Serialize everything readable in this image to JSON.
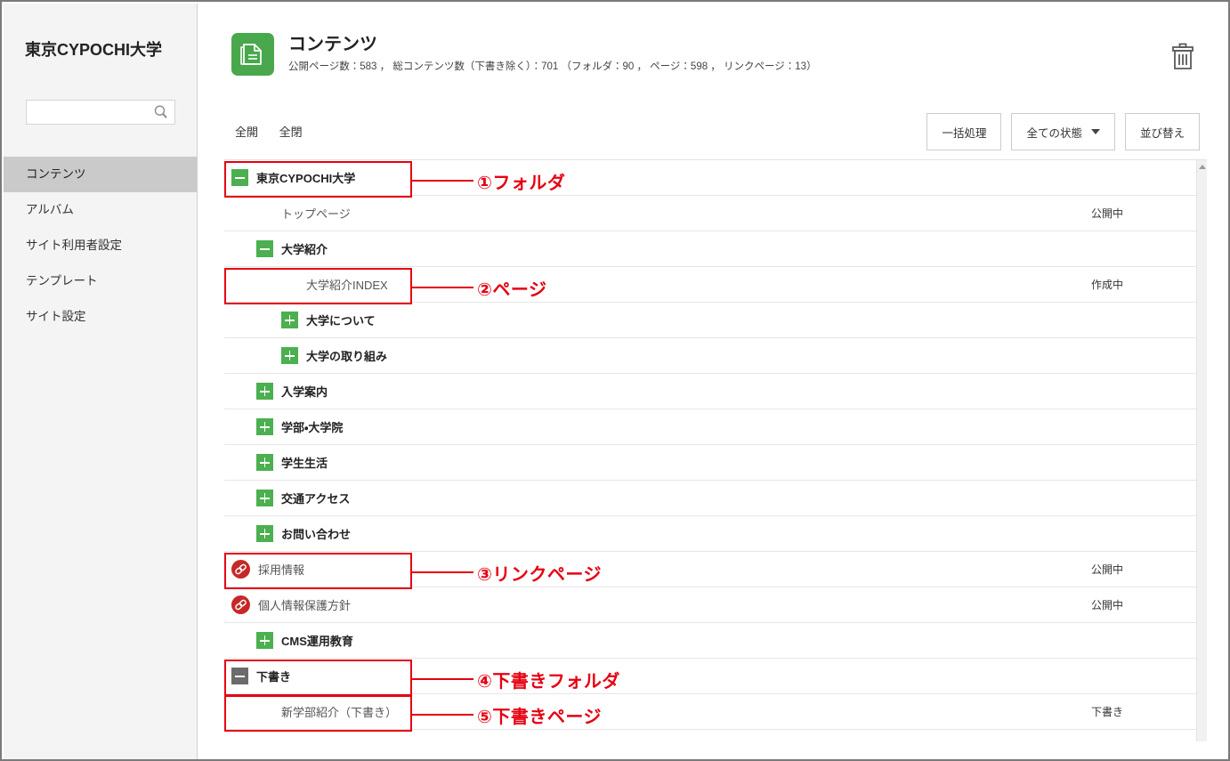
{
  "sidebar": {
    "site_title": "東京CYPOCHI大学",
    "search": {
      "value": "",
      "placeholder": "",
      "icon": "search-icon"
    },
    "items": [
      {
        "label": "コンテンツ",
        "active": true
      },
      {
        "label": "アルバム",
        "active": false
      },
      {
        "label": "サイト利用者設定",
        "active": false
      },
      {
        "label": "テンプレート",
        "active": false
      },
      {
        "label": "サイト設定",
        "active": false
      }
    ]
  },
  "header": {
    "icon": "content-document-icon",
    "title": "コンテンツ",
    "stats": "公開ページ数：583 ， 総コンテンツ数（下書き除く）：701 （フォルダ：90 ， ページ：598 ， リンクページ：13）",
    "trash_icon": "trash-icon"
  },
  "toolbar": {
    "expand_all_label": "全開",
    "collapse_all_label": "全閉",
    "bulk_label": "一括処理",
    "status_filter_label": "全ての状態",
    "status_filter_icon": "chevron-down-icon",
    "sort_label": "並び替え"
  },
  "tree": {
    "rows": [
      {
        "label": "東京CYPOCHI大学",
        "type": "folder",
        "indent": 0,
        "toggle": "minus",
        "toggle_color": "green",
        "status": ""
      },
      {
        "label": "トップページ",
        "type": "page",
        "indent": 1,
        "toggle": "none",
        "toggle_color": "",
        "status": "公開中"
      },
      {
        "label": "大学紹介",
        "type": "folder",
        "indent": 1,
        "toggle": "minus",
        "toggle_color": "green",
        "status": ""
      },
      {
        "label": "大学紹介INDEX",
        "type": "page",
        "indent": 2,
        "toggle": "none",
        "toggle_color": "",
        "status": "作成中"
      },
      {
        "label": "大学について",
        "type": "folder",
        "indent": 2,
        "toggle": "plus",
        "toggle_color": "green",
        "status": ""
      },
      {
        "label": "大学の取り組み",
        "type": "folder",
        "indent": 2,
        "toggle": "plus",
        "toggle_color": "green",
        "status": ""
      },
      {
        "label": "入学案内",
        "type": "folder",
        "indent": 1,
        "toggle": "plus",
        "toggle_color": "green",
        "status": ""
      },
      {
        "label": "学部・大学院",
        "type": "folder",
        "indent": 1,
        "toggle": "plus",
        "toggle_color": "green",
        "status": ""
      },
      {
        "label": "学生生活",
        "type": "folder",
        "indent": 1,
        "toggle": "plus",
        "toggle_color": "green",
        "status": ""
      },
      {
        "label": "交通アクセス",
        "type": "folder",
        "indent": 1,
        "toggle": "plus",
        "toggle_color": "green",
        "status": ""
      },
      {
        "label": "お問い合わせ",
        "type": "folder",
        "indent": 1,
        "toggle": "plus",
        "toggle_color": "green",
        "status": ""
      },
      {
        "label": "採用情報",
        "type": "link",
        "indent": 0,
        "toggle": "link",
        "toggle_color": "red",
        "status": "公開中"
      },
      {
        "label": "個人情報保護方針",
        "type": "link",
        "indent": 0,
        "toggle": "link",
        "toggle_color": "red",
        "status": "公開中"
      },
      {
        "label": "CMS運用教育",
        "type": "folder",
        "indent": 1,
        "toggle": "plus",
        "toggle_color": "green",
        "status": ""
      },
      {
        "label": "下書き",
        "type": "folder",
        "indent": 0,
        "toggle": "minus",
        "toggle_color": "gray",
        "status": ""
      },
      {
        "label": "新学部紹介（下書き）",
        "type": "page",
        "indent": 1,
        "toggle": "none",
        "toggle_color": "",
        "status": "下書き"
      }
    ]
  },
  "annotations": {
    "color": "#e60012",
    "items": [
      {
        "text": "①フォルダ",
        "target_row": 0
      },
      {
        "text": "②ページ",
        "target_row": 3
      },
      {
        "text": "③リンクページ",
        "target_row": 11
      },
      {
        "text": "④下書きフォルダ",
        "target_row": 14
      },
      {
        "text": "⑤下書きページ",
        "target_row": 15
      }
    ]
  }
}
